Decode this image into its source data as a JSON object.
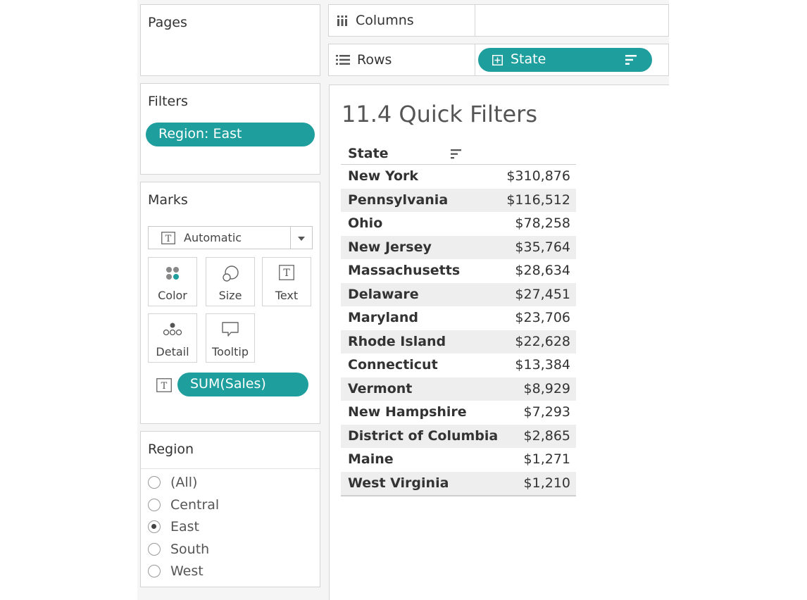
{
  "pages": {
    "title": "Pages"
  },
  "shelves": {
    "columns_label": "Columns",
    "rows_label": "Rows",
    "rows_pill": "State"
  },
  "filters": {
    "title": "Filters",
    "pill": "Region: East"
  },
  "marks": {
    "title": "Marks",
    "type": "Automatic",
    "buttons": [
      {
        "label": "Color",
        "icon": "color-icon"
      },
      {
        "label": "Size",
        "icon": "size-icon"
      },
      {
        "label": "Text",
        "icon": "text-icon"
      },
      {
        "label": "Detail",
        "icon": "detail-icon"
      },
      {
        "label": "Tooltip",
        "icon": "tooltip-icon"
      }
    ],
    "text_pill": "SUM(Sales)"
  },
  "region_filter": {
    "title": "Region",
    "options": [
      "(All)",
      "Central",
      "East",
      "South",
      "West"
    ],
    "selected": "East"
  },
  "viz": {
    "title": "11.4 Quick Filters",
    "column_header": "State",
    "rows": [
      {
        "state": "New York",
        "value": "$310,876"
      },
      {
        "state": "Pennsylvania",
        "value": "$116,512"
      },
      {
        "state": "Ohio",
        "value": "$78,258"
      },
      {
        "state": "New Jersey",
        "value": "$35,764"
      },
      {
        "state": "Massachusetts",
        "value": "$28,634"
      },
      {
        "state": "Delaware",
        "value": "$27,451"
      },
      {
        "state": "Maryland",
        "value": "$23,706"
      },
      {
        "state": "Rhode Island",
        "value": "$22,628"
      },
      {
        "state": "Connecticut",
        "value": "$13,384"
      },
      {
        "state": "Vermont",
        "value": "$8,929"
      },
      {
        "state": "New Hampshire",
        "value": "$7,293"
      },
      {
        "state": "District of Columbia",
        "value": "$2,865"
      },
      {
        "state": "Maine",
        "value": "$1,271"
      },
      {
        "state": "West Virginia",
        "value": "$1,210"
      }
    ]
  },
  "colors": {
    "accent": "#1f9e9e",
    "panel_bg": "#f5f5f5",
    "border": "#d4d4d4"
  }
}
